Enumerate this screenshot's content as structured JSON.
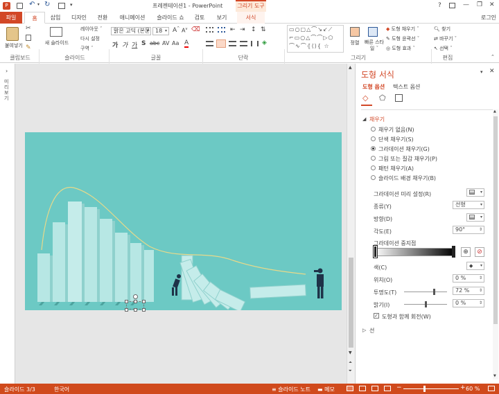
{
  "title": {
    "text": "프레젠테이션1 - PowerPoint",
    "context_tab": "그리기 도구",
    "help": "?",
    "min": "—",
    "restore": "❐",
    "close": "✕"
  },
  "tabs": [
    "파일",
    "홈",
    "삽입",
    "디자인",
    "전환",
    "애니메이션",
    "슬라이드 쇼",
    "검토",
    "보기",
    "서식"
  ],
  "login": "로그인",
  "ribbon": {
    "paste": "붙여넣기",
    "new_slide": "새 슬라이드",
    "layout": "레이아웃 ˇ",
    "reset": "다시 설정",
    "section": "구역 ˇ",
    "font_name": "맑은 고딕 (본문",
    "font_size": "18",
    "arrange": "정렬",
    "quick_styles": "빠른 스타일 ˇ",
    "shape_fill": "도형 채우기 ˇ",
    "shape_outline": "도형 윤곽선 ˇ",
    "shape_effects": "도형 효과 ˇ",
    "find": "찾기",
    "replace": "바꾸기 ˇ",
    "select": "선택 ˇ",
    "groups": [
      "클립보드",
      "슬라이드",
      "글꼴",
      "단락",
      "그리기",
      "편집"
    ]
  },
  "thumbnails_label": "미리 보기",
  "pane": {
    "title": "도형 서식",
    "tab_shape": "도형 옵션",
    "tab_text": "텍스트 옵션",
    "fill_section": "채우기",
    "fill_options": [
      "채우기 없음(N)",
      "단색 채우기(S)",
      "그라데이션 채우기(G)",
      "그림 또는 질감 채우기(P)",
      "패턴 채우기(A)",
      "슬라이드 배경 채우기(B)"
    ],
    "fill_selected": 2,
    "preset_label": "그라데이션 미리 설정(R)",
    "type_label": "종류(Y)",
    "type_value": "선형",
    "direction_label": "방향(D)",
    "angle_label": "각도(E)",
    "angle_value": "90°",
    "stops_label": "그라데이션 중지점",
    "color_label": "색(C)",
    "position_label": "위치(O)",
    "position_value": "0 %",
    "transparency_label": "투명도(T)",
    "transparency_value": "72 %",
    "brightness_label": "밝기(I)",
    "brightness_value": "0 %",
    "rotate_with_shape": "도형과 함께 회전(W)",
    "line_section": "선"
  },
  "status": {
    "slide": "슬라이드 3/3",
    "language": "한국어",
    "notes": "슬라이드 노트",
    "comments": "메모",
    "zoom": "60 %"
  },
  "colors": {
    "accent": "#d24726",
    "slide_bg": "#6cc9c4",
    "status_bg": "#d04a1c"
  }
}
